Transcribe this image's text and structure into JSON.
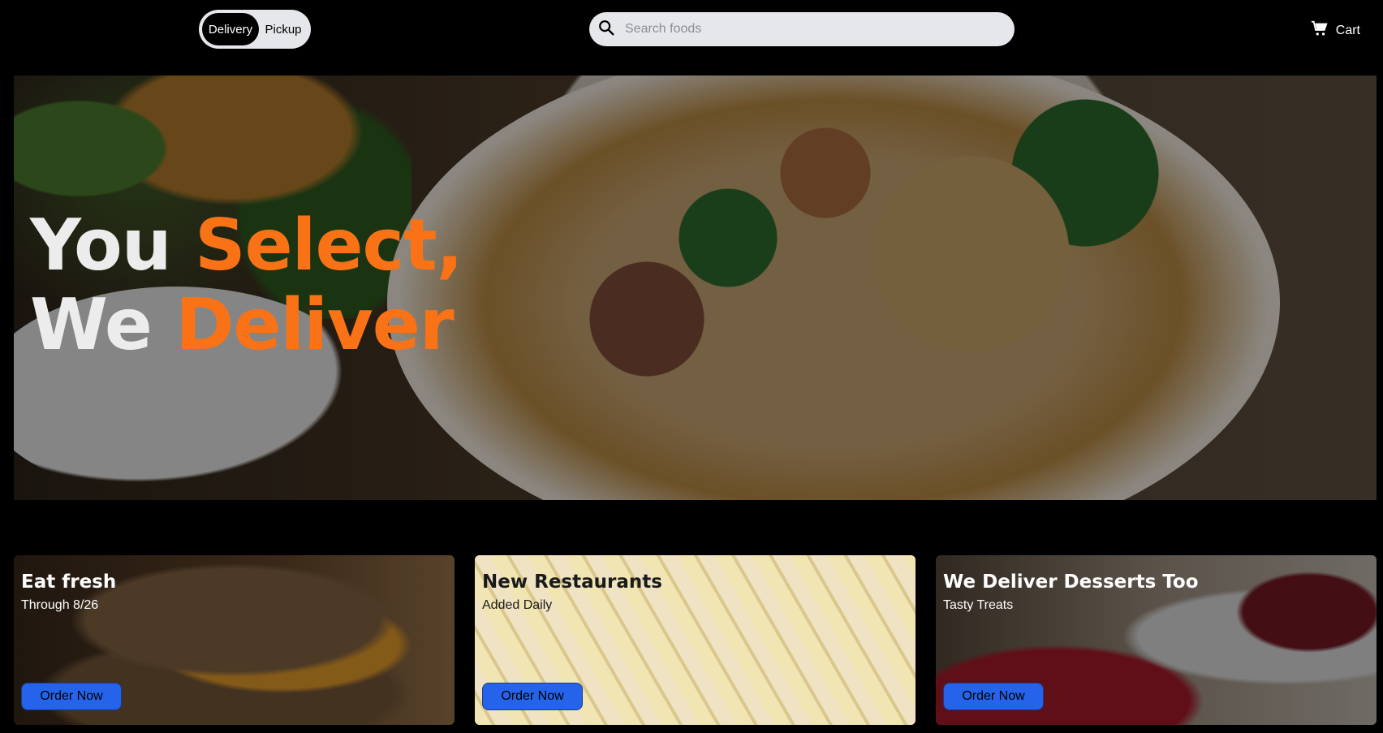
{
  "header": {
    "mode_toggle": {
      "options": [
        "Delivery",
        "Pickup"
      ],
      "selected": "Delivery"
    },
    "search": {
      "placeholder": "Search foods",
      "value": ""
    },
    "cart_label": "Cart"
  },
  "hero": {
    "line1_white": "You",
    "line1_orange": "Select,",
    "line2_white": "We",
    "line2_orange": "Deliver"
  },
  "cards": [
    {
      "title": "Eat fresh",
      "subtitle": "Through 8/26",
      "button": "Order Now"
    },
    {
      "title": "New Restaurants",
      "subtitle": "Added Daily",
      "button": "Order Now"
    },
    {
      "title": "We Deliver Desserts Too",
      "subtitle": "Tasty Treats",
      "button": "Order Now"
    }
  ],
  "colors": {
    "accent": "#f97316",
    "button": "#2563eb",
    "background": "#000000"
  },
  "icons": {
    "search": "search-icon",
    "cart": "cart-icon"
  }
}
